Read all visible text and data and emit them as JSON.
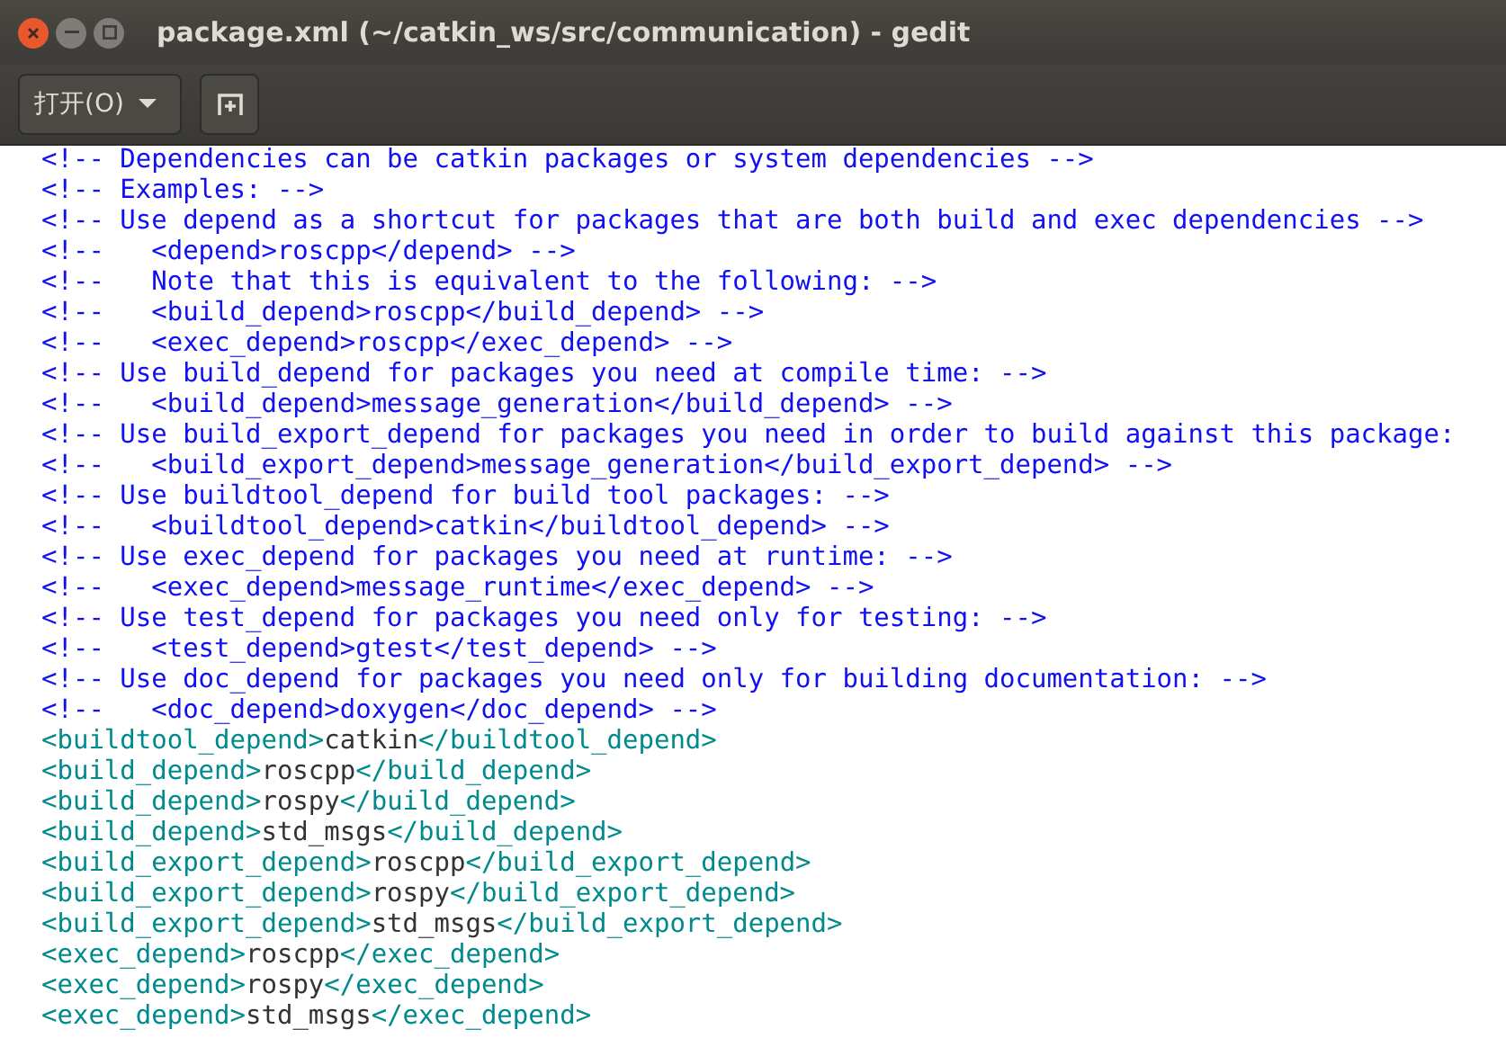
{
  "window": {
    "title": "package.xml (~/catkin_ws/src/communication) - gedit"
  },
  "toolbar": {
    "open_button": {
      "label": "打开(O)"
    }
  },
  "lines": [
    {
      "kind": "comment",
      "text": "<!-- Dependencies can be catkin packages or system dependencies -->"
    },
    {
      "kind": "comment",
      "text": "<!-- Examples: -->"
    },
    {
      "kind": "comment",
      "text": "<!-- Use depend as a shortcut for packages that are both build and exec dependencies -->"
    },
    {
      "kind": "comment",
      "text": "<!--   <depend>roscpp</depend> -->"
    },
    {
      "kind": "comment",
      "text": "<!--   Note that this is equivalent to the following: -->"
    },
    {
      "kind": "comment",
      "text": "<!--   <build_depend>roscpp</build_depend> -->"
    },
    {
      "kind": "comment",
      "text": "<!--   <exec_depend>roscpp</exec_depend> -->"
    },
    {
      "kind": "comment",
      "text": "<!-- Use build_depend for packages you need at compile time: -->"
    },
    {
      "kind": "comment",
      "text": "<!--   <build_depend>message_generation</build_depend> -->"
    },
    {
      "kind": "comment",
      "text": "<!-- Use build_export_depend for packages you need in order to build against this package:"
    },
    {
      "kind": "comment",
      "text": "<!--   <build_export_depend>message_generation</build_export_depend> -->"
    },
    {
      "kind": "comment",
      "text": "<!-- Use buildtool_depend for build tool packages: -->"
    },
    {
      "kind": "comment",
      "text": "<!--   <buildtool_depend>catkin</buildtool_depend> -->"
    },
    {
      "kind": "comment",
      "text": "<!-- Use exec_depend for packages you need at runtime: -->"
    },
    {
      "kind": "comment",
      "text": "<!--   <exec_depend>message_runtime</exec_depend> -->"
    },
    {
      "kind": "comment",
      "text": "<!-- Use test_depend for packages you need only for testing: -->"
    },
    {
      "kind": "comment",
      "text": "<!--   <test_depend>gtest</test_depend> -->"
    },
    {
      "kind": "comment",
      "text": "<!-- Use doc_depend for packages you need only for building documentation: -->"
    },
    {
      "kind": "comment",
      "text": "<!--   <doc_depend>doxygen</doc_depend> -->"
    },
    {
      "kind": "element",
      "open": "<buildtool_depend>",
      "value": "catkin",
      "close": "</buildtool_depend>"
    },
    {
      "kind": "element",
      "open": "<build_depend>",
      "value": "roscpp",
      "close": "</build_depend>"
    },
    {
      "kind": "element",
      "open": "<build_depend>",
      "value": "rospy",
      "close": "</build_depend>"
    },
    {
      "kind": "element",
      "open": "<build_depend>",
      "value": "std_msgs",
      "close": "</build_depend>"
    },
    {
      "kind": "element",
      "open": "<build_export_depend>",
      "value": "roscpp",
      "close": "</build_export_depend>"
    },
    {
      "kind": "element",
      "open": "<build_export_depend>",
      "value": "rospy",
      "close": "</build_export_depend>"
    },
    {
      "kind": "element",
      "open": "<build_export_depend>",
      "value": "std_msgs",
      "close": "</build_export_depend>"
    },
    {
      "kind": "element",
      "open": "<exec_depend>",
      "value": "roscpp",
      "close": "</exec_depend>"
    },
    {
      "kind": "element",
      "open": "<exec_depend>",
      "value": "rospy",
      "close": "</exec_depend>"
    },
    {
      "kind": "element",
      "open": "<exec_depend>",
      "value": "std_msgs",
      "close": "</exec_depend>"
    }
  ]
}
